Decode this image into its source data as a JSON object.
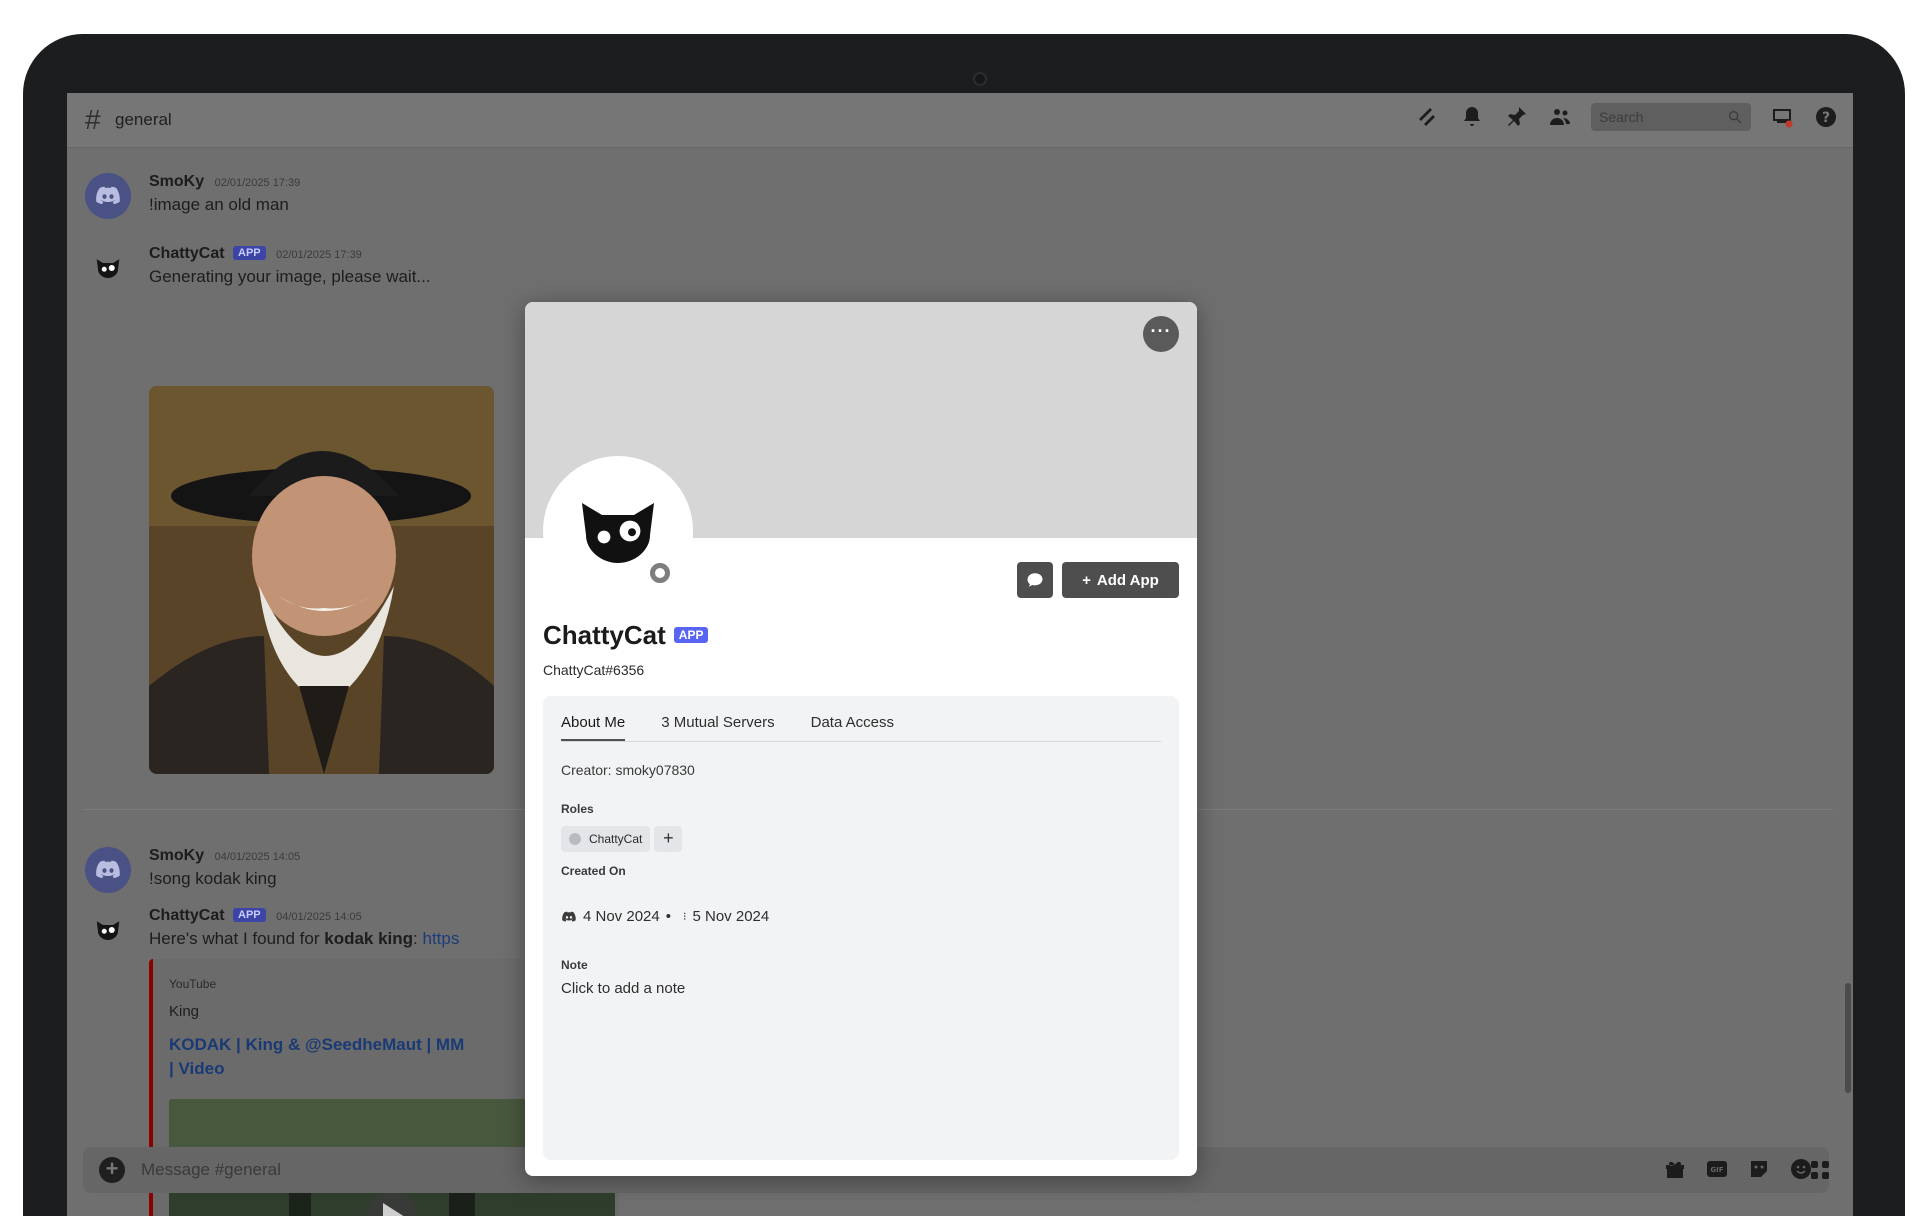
{
  "header": {
    "channel_name": "general",
    "search_placeholder": "Search"
  },
  "messages": [
    {
      "user": "SmoKy",
      "timestamp": "02/01/2025 17:39",
      "text": "!image an old man"
    },
    {
      "user": "ChattyCat",
      "badge": "APP",
      "timestamp": "02/01/2025 17:39",
      "text": "Generating your image, please wait..."
    },
    {
      "user": "SmoKy",
      "timestamp": "04/01/2025 14:05",
      "text": "!song kodak king"
    },
    {
      "user": "ChattyCat",
      "badge": "APP",
      "timestamp": "04/01/2025 14:05",
      "text_prefix": "Here's what I found for ",
      "text_bold": "kodak king",
      "text_suffix": ": ",
      "link_text": "https"
    }
  ],
  "embed": {
    "provider": "YouTube",
    "author": "King",
    "title": "KODAK | King & @SeedheMaut | MM | Video"
  },
  "composer": {
    "placeholder": "Message #general"
  },
  "profile": {
    "name": "ChattyCat",
    "badge": "APP",
    "tag": "ChattyCat#6356",
    "more_label": "···",
    "add_app_label": "Add App",
    "tabs": [
      "About Me",
      "3 Mutual Servers",
      "Data Access"
    ],
    "creator": "Creator: smoky07830",
    "roles_heading": "Roles",
    "role_name": "ChattyCat",
    "role_add": "+",
    "created_heading": "Created On",
    "created_discord": "4 Nov 2024",
    "created_separator": "•",
    "created_server": "5 Nov 2024",
    "note_heading": "Note",
    "note_placeholder": "Click to add a note"
  }
}
